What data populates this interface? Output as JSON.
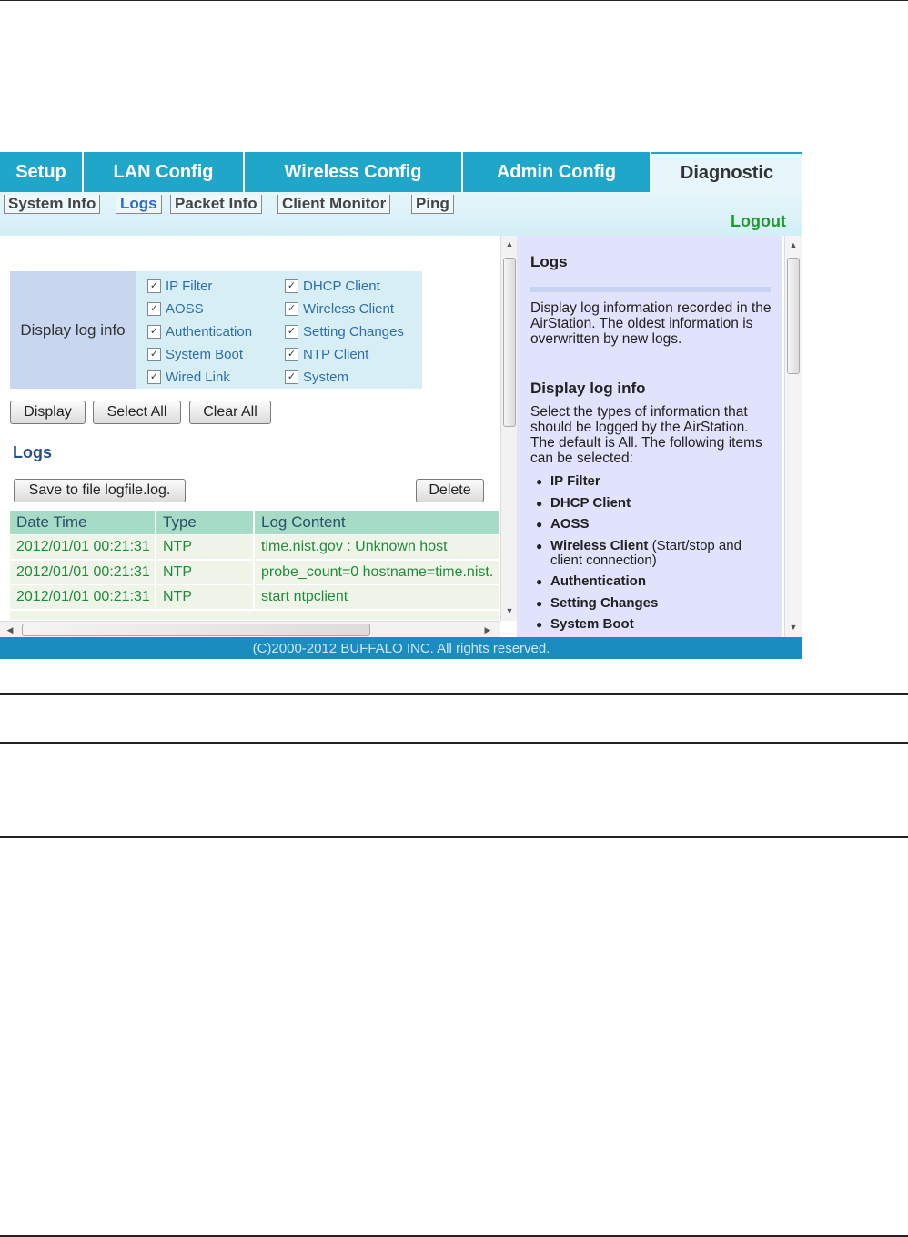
{
  "tabs": [
    "Setup",
    "LAN Config",
    "Wireless Config",
    "Admin Config",
    "Diagnostic"
  ],
  "subtabs": [
    "System Info",
    "Logs",
    "Packet Info",
    "Client Monitor",
    "Ping"
  ],
  "logout": "Logout",
  "loginfo": {
    "label": "Display log info",
    "options": [
      "IP Filter",
      "DHCP Client",
      "AOSS",
      "Wireless Client",
      "Authentication",
      "Setting Changes",
      "System Boot",
      "NTP Client",
      "Wired Link",
      "System"
    ]
  },
  "buttons": {
    "display": "Display",
    "select_all": "Select All",
    "clear_all": "Clear All",
    "save": "Save to file logfile.log.",
    "delete": "Delete"
  },
  "logs_title": "Logs",
  "table": {
    "headers": [
      "Date Time",
      "Type",
      "Log Content"
    ],
    "rows": [
      [
        "2012/01/01 00:21:31",
        "NTP",
        "time.nist.gov : Unknown host"
      ],
      [
        "2012/01/01 00:21:31",
        "NTP",
        "probe_count=0 hostname=time.nist."
      ],
      [
        "2012/01/01 00:21:31",
        "NTP",
        "start ntpclient"
      ]
    ]
  },
  "help": {
    "title": "Logs",
    "intro": "Display log information recorded in the AirStation. The oldest information is overwritten by new logs.",
    "section": "Display log info",
    "section_text": "Select the types of information that should be logged by the AirStation. The default is All. The following items can be selected:",
    "items": [
      {
        "bold": "IP Filter",
        "rest": ""
      },
      {
        "bold": "DHCP Client",
        "rest": ""
      },
      {
        "bold": "AOSS",
        "rest": ""
      },
      {
        "bold": "Wireless Client",
        "rest": " (Start/stop and",
        "rest2": "client connection)"
      },
      {
        "bold": "Authentication",
        "rest": ""
      },
      {
        "bold": "Setting Changes",
        "rest": ""
      },
      {
        "bold": "System Boot",
        "rest": ""
      }
    ]
  },
  "footer": "(C)2000-2012 BUFFALO INC. All rights reserved.",
  "icons": {
    "checkbox": "checkmark-icon",
    "scroll_up": "arrow-up-icon",
    "scroll_down": "arrow-down-icon",
    "scroll_left": "arrow-left-icon",
    "scroll_right": "arrow-right-icon"
  },
  "colors": {
    "tab": "#1fa6c9",
    "active_tab": "#e6f6fa",
    "logout": "#1e9a2c",
    "footer": "#1a8cc0",
    "help_bg": "#e1e2fc"
  }
}
